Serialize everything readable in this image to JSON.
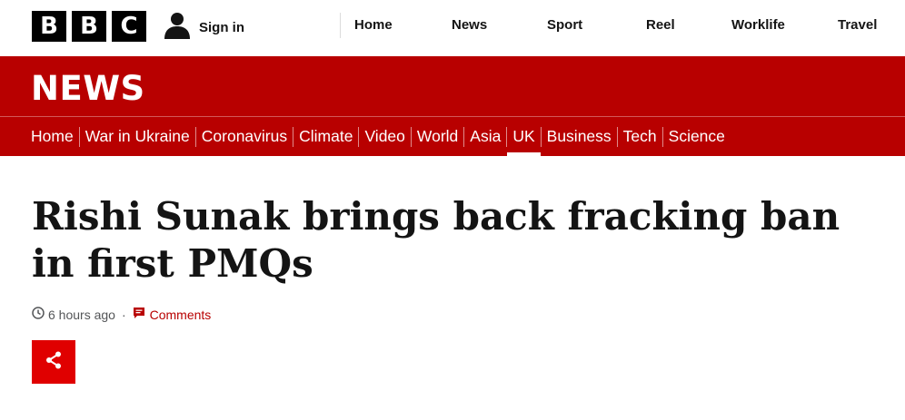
{
  "masthead": {
    "logo_letters": [
      "B",
      "B",
      "C"
    ],
    "signin_label": "Sign in",
    "nav": [
      "Home",
      "News",
      "Sport",
      "Reel",
      "Worklife",
      "Travel"
    ]
  },
  "news_band": {
    "wordmark": "NEWS",
    "sections": [
      "Home",
      "War in Ukraine",
      "Coronavirus",
      "Climate",
      "Video",
      "World",
      "Asia",
      "UK",
      "Business",
      "Tech",
      "Science"
    ],
    "active_section": "UK"
  },
  "article": {
    "headline": "Rishi Sunak brings back fracking ban in first PMQs",
    "timestamp": "6 hours ago",
    "separator": "·",
    "comments_label": "Comments"
  },
  "colors": {
    "brand_red": "#b80000",
    "share_red": "#e00000",
    "text": "#141414",
    "meta": "#545658"
  },
  "icons": {
    "user": "user-icon",
    "clock": "clock-icon",
    "comments": "comment-icon",
    "share": "share-icon"
  }
}
